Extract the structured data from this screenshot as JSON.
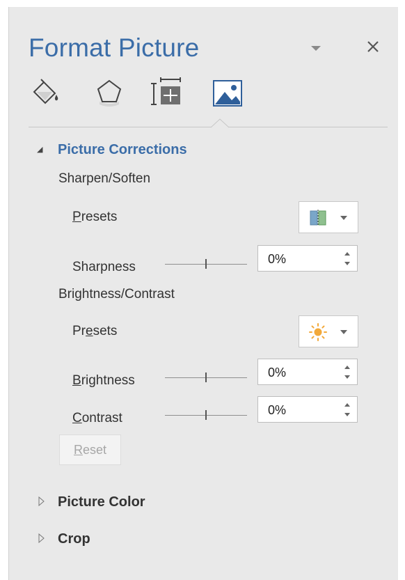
{
  "pane": {
    "title": "Format Picture",
    "menu_icon": "chevron-down-icon",
    "close_icon": "close-icon",
    "tabs": [
      {
        "name": "Fill & Line",
        "icon": "paint-bucket-icon"
      },
      {
        "name": "Effects",
        "icon": "pentagon-icon"
      },
      {
        "name": "Size & Properties",
        "icon": "size-properties-icon"
      },
      {
        "name": "Picture",
        "icon": "picture-icon",
        "selected": true
      }
    ]
  },
  "picture_corrections": {
    "header": "Picture Corrections",
    "state": "expanded",
    "sharpen": {
      "heading": "Sharpen/Soften",
      "presets_label_accel": "P",
      "presets_label_rest": "resets",
      "sharpness_label": "Sharpness",
      "sharpness_value": "0%",
      "sharpness_level": 0
    },
    "brightness_contrast": {
      "heading": "Brightness/Contrast",
      "presets_label_pre": "Pr",
      "presets_label_accel": "e",
      "presets_label_post": "sets",
      "brightness_label_accel": "B",
      "brightness_label_rest": "rightness",
      "brightness_value": "0%",
      "brightness_level": 0,
      "contrast_label_accel": "C",
      "contrast_label_rest": "ontrast",
      "contrast_value": "0%",
      "contrast_level": 0
    },
    "reset_label_accel": "R",
    "reset_label_rest": "eset"
  },
  "picture_color": {
    "header": "Picture Color",
    "state": "collapsed"
  },
  "crop": {
    "header": "Crop",
    "state": "collapsed"
  },
  "colors": {
    "accent": "#3b6da8",
    "pane_background": "#e9e9e9",
    "sun_icon": "#f2a93b"
  }
}
